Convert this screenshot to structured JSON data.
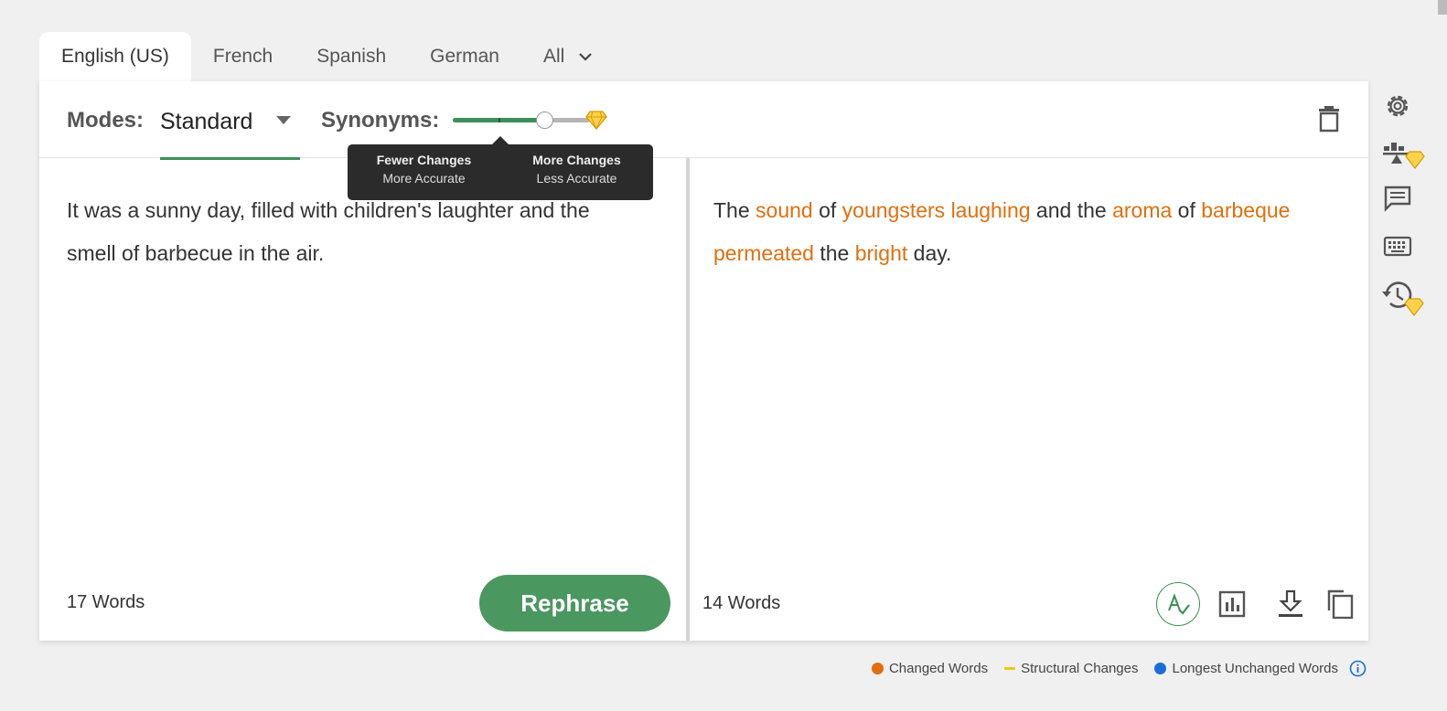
{
  "tabs": [
    {
      "label": "English (US)",
      "active": true
    },
    {
      "label": "French"
    },
    {
      "label": "Spanish"
    },
    {
      "label": "German"
    },
    {
      "label": "All"
    }
  ],
  "toolbar": {
    "modes_label": "Modes:",
    "mode_value": "Standard",
    "synonyms_label": "Synonyms:",
    "synonyms_level": 0.67
  },
  "tooltip": {
    "left_title": "Fewer Changes",
    "left_sub": "More Accurate",
    "right_title": "More Changes",
    "right_sub": "Less Accurate"
  },
  "input": {
    "text": "It was a sunny day, filled with children's laughter and the smell of barbecue in the air.",
    "word_count": "17 Words"
  },
  "rephrase_label": "Rephrase",
  "output": {
    "segments": [
      {
        "text": "The ",
        "changed": false
      },
      {
        "text": "sound",
        "changed": true
      },
      {
        "text": " of ",
        "changed": false
      },
      {
        "text": "youngsters laughing",
        "changed": true
      },
      {
        "text": " and the ",
        "changed": false
      },
      {
        "text": "aroma",
        "changed": true
      },
      {
        "text": " of ",
        "changed": false
      },
      {
        "text": "barbeque permeated",
        "changed": true
      },
      {
        "text": " the ",
        "changed": false
      },
      {
        "text": "bright",
        "changed": true
      },
      {
        "text": " day.",
        "changed": false
      }
    ],
    "word_count": "14 Words"
  },
  "legend": {
    "changed": "Changed Words",
    "structural": "Structural Changes",
    "unchanged": "Longest Unchanged Words"
  },
  "colors": {
    "accent_green": "#3e8f57",
    "changed_orange": "#e06f0f",
    "structural_yellow": "#f3c614",
    "unchanged_blue": "#1a6fd6",
    "premium_gold": "#f0b400"
  },
  "icons": [
    "chevron-down-icon",
    "gem-icon",
    "trash-icon",
    "grammar-check-icon",
    "stats-icon",
    "download-icon",
    "copy-icon",
    "gear-icon",
    "compare-icon",
    "feedback-icon",
    "keyboard-icon",
    "history-icon",
    "info-icon"
  ]
}
